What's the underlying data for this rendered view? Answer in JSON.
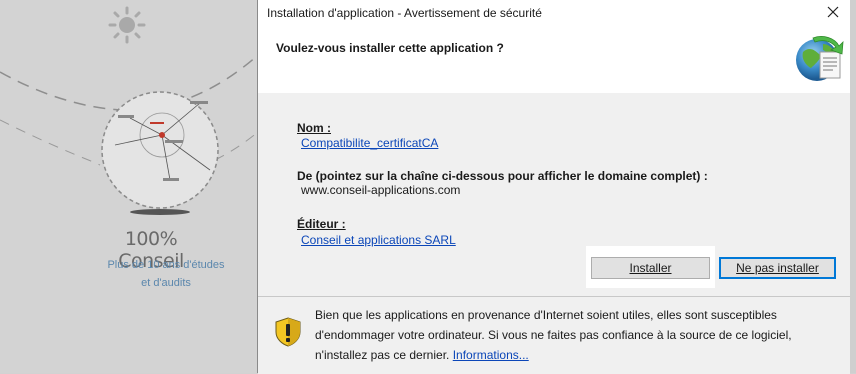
{
  "background_page": {
    "title": "100% Conseil",
    "subtitle_line1": "Plus de 10 ans d'études",
    "subtitle_line2": "et d'audits"
  },
  "dialog": {
    "title": "Installation d'application - Avertissement de sécurité",
    "question": "Voulez-vous installer cette application ?",
    "name_label": "Nom :",
    "name_value": "Compatibilite_certificatCA",
    "from_label": "De (pointez sur la chaîne ci-dessous pour afficher le domaine complet) :",
    "from_value": "www.conseil-applications.com",
    "publisher_label": "Éditeur :",
    "publisher_value": "Conseil et applications SARL",
    "install_button": "Installer",
    "no_install_button": "Ne pas installer",
    "warning_text": "Bien que les applications en provenance d'Internet soient utiles, elles sont susceptibles d'endommager votre ordinateur. Si vous ne faites pas confiance à la source de ce logiciel, n'installez pas ce dernier.",
    "warning_link": "Informations..."
  },
  "icons": {
    "close": "close-icon",
    "app": "application-install-icon",
    "warning": "shield-warning-icon",
    "sun": "sun-icon"
  },
  "colors": {
    "link": "#0b46b8",
    "dialog_bg": "#f0f0f0",
    "default_button_border": "#0078d7",
    "background_overlay": "#d3d3d3"
  }
}
